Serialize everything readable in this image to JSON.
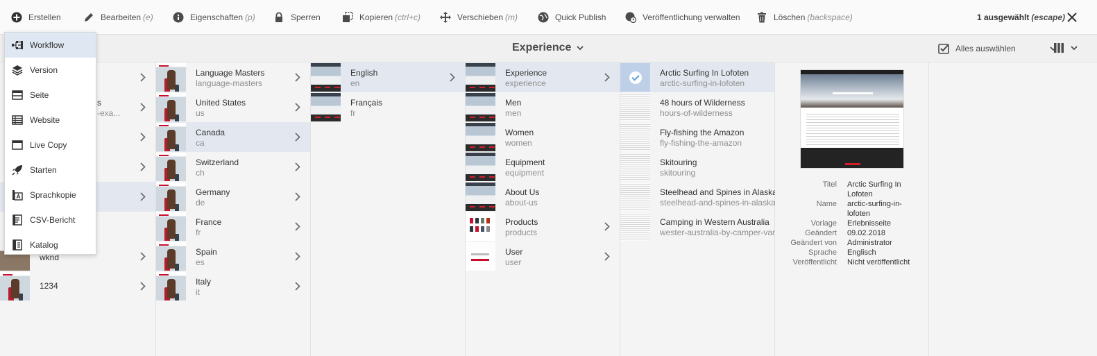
{
  "toolbar": {
    "create": "Erstellen",
    "edit": "Bearbeiten",
    "edit_shortcut": "(e)",
    "properties": "Eigenschaften",
    "properties_shortcut": "(p)",
    "lock": "Sperren",
    "copy": "Kopieren",
    "copy_shortcut": "(ctrl+c)",
    "move": "Verschieben",
    "move_shortcut": "(m)",
    "quick_publish": "Quick Publish",
    "manage_publication": "Veröffentlichung verwalten",
    "delete": "Löschen",
    "delete_shortcut": "(backspace)",
    "selection_count": "1 ausgewählt",
    "selection_escape": "(escape)"
  },
  "titlebar": {
    "title": "Experience",
    "select_all": "Alles auswählen"
  },
  "create_menu": {
    "items": [
      {
        "label": "Workflow",
        "icon": "workflow-icon"
      },
      {
        "label": "Version",
        "icon": "layers-icon"
      },
      {
        "label": "Seite",
        "icon": "page-icon"
      },
      {
        "label": "Website",
        "icon": "website-icon"
      },
      {
        "label": "Live Copy",
        "icon": "live-copy-icon"
      },
      {
        "label": "Starten",
        "icon": "rocket-icon"
      },
      {
        "label": "Sprachkopie",
        "icon": "language-copy-icon"
      },
      {
        "label": "CSV-Bericht",
        "icon": "csv-report-icon"
      },
      {
        "label": "Katalog",
        "icon": "catalog-icon"
      }
    ]
  },
  "column1": {
    "partial_title": "s",
    "partial_sub": "-exa...",
    "items": [
      {
        "title": "wknd"
      },
      {
        "title": "1234"
      }
    ]
  },
  "column2": {
    "items": [
      {
        "title": "Language Masters",
        "name": "language-masters"
      },
      {
        "title": "United States",
        "name": "us"
      },
      {
        "title": "Canada",
        "name": "ca"
      },
      {
        "title": "Switzerland",
        "name": "ch"
      },
      {
        "title": "Germany",
        "name": "de"
      },
      {
        "title": "France",
        "name": "fr"
      },
      {
        "title": "Spain",
        "name": "es"
      },
      {
        "title": "Italy",
        "name": "it"
      }
    ]
  },
  "column3": {
    "items": [
      {
        "title": "English",
        "name": "en"
      },
      {
        "title": "Français",
        "name": "fr"
      }
    ]
  },
  "column4": {
    "items": [
      {
        "title": "Experience",
        "name": "experience"
      },
      {
        "title": "Men",
        "name": "men"
      },
      {
        "title": "Women",
        "name": "women"
      },
      {
        "title": "Equipment",
        "name": "equipment"
      },
      {
        "title": "About Us",
        "name": "about-us"
      },
      {
        "title": "Products",
        "name": "products"
      },
      {
        "title": "User",
        "name": "user"
      }
    ]
  },
  "column5": {
    "items": [
      {
        "title": "Arctic Surfing In Lofoten",
        "name": "arctic-surfing-in-lofoten"
      },
      {
        "title": "48 hours of Wilderness",
        "name": "hours-of-wilderness"
      },
      {
        "title": "Fly-fishing the Amazon",
        "name": "fly-fishing-the-amazon"
      },
      {
        "title": "Skitouring",
        "name": "skitouring"
      },
      {
        "title": "Steelhead and Spines in Alaska",
        "name": "steelhead-and-spines-in-alaska"
      },
      {
        "title": "Camping in Western Australia",
        "name": "wester-australia-by-camper-van"
      }
    ]
  },
  "meta": {
    "title_label": "Titel",
    "title_value": "Arctic Surfing In Lofoten",
    "name_label": "Name",
    "name_value": "arctic-surfing-in-lofoten",
    "template_label": "Vorlage",
    "template_value": "Erlebnisseite",
    "modified_label": "Geändert",
    "modified_value": "09.02.2018",
    "modified_by_label": "Geändert von",
    "modified_by_value": "Administrator",
    "language_label": "Sprache",
    "language_value": "Englisch",
    "published_label": "Veröffentlicht",
    "published_value": "Nicht veröffentlicht"
  }
}
